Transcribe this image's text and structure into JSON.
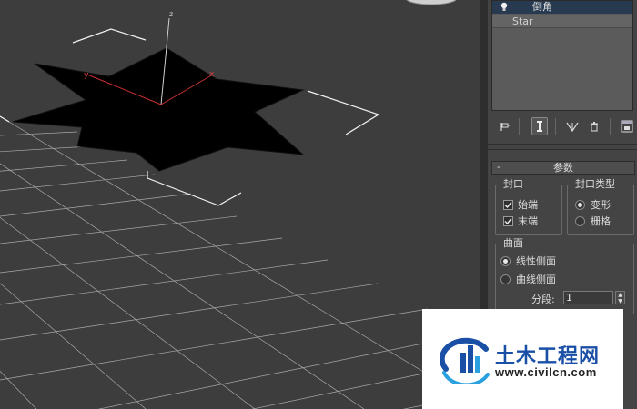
{
  "viewport": {
    "axis_y": "y",
    "axis_x": "x",
    "axis_z": "z"
  },
  "stack": {
    "selected_modifier": "倒角",
    "base_object": "Star"
  },
  "toolbar": {
    "icons": [
      "pin-stack-icon",
      "show-end-result-icon",
      "make-unique-icon",
      "remove-modifier-icon",
      "configure-sets-icon"
    ]
  },
  "parameters": {
    "rollout_title": "参数",
    "collapse_symbol": "-",
    "cap_group": {
      "label": "封口",
      "start": {
        "label": "始端",
        "checked": true
      },
      "end": {
        "label": "末端",
        "checked": true
      }
    },
    "cap_type_group": {
      "label": "封口类型",
      "morph": {
        "label": "变形",
        "selected": true
      },
      "grid": {
        "label": "栅格",
        "selected": false
      }
    },
    "surface_group": {
      "label": "曲面",
      "linear_sides": {
        "label": "线性侧面",
        "selected": true
      },
      "curved_sides": {
        "label": "曲线侧面",
        "selected": false
      },
      "segments_label": "分段:",
      "segments_value": "1"
    }
  },
  "watermark": {
    "title": "土木工程网",
    "url": "www.civilcn.com"
  }
}
